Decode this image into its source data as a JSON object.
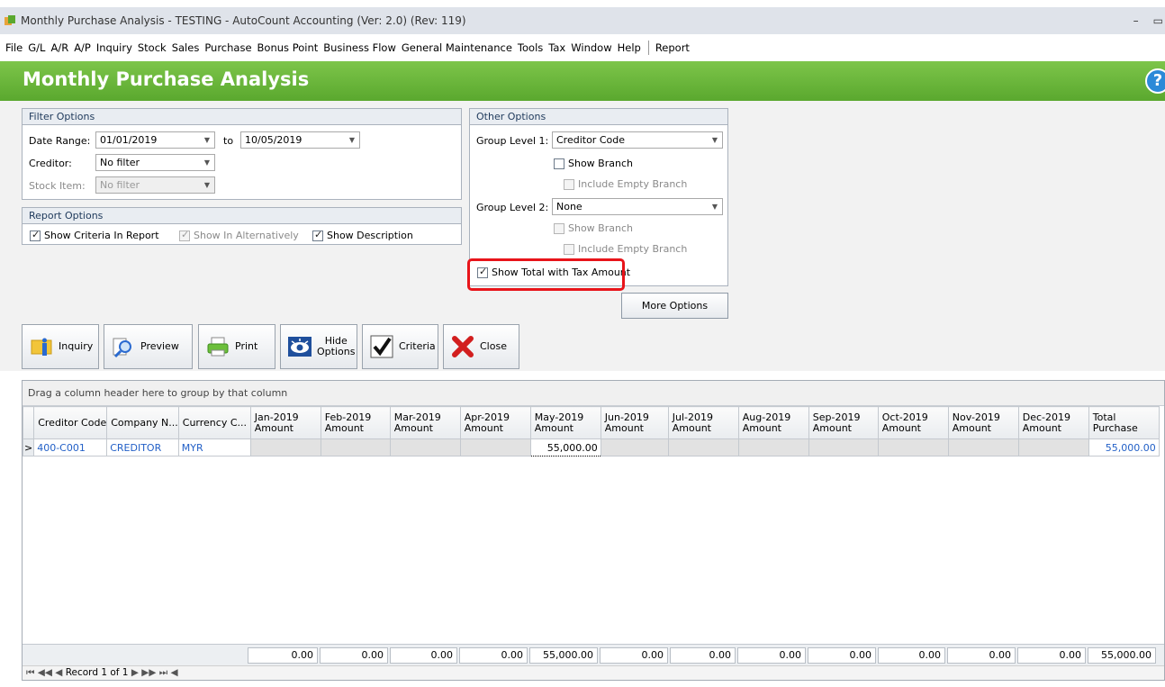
{
  "window": {
    "title": "Monthly Purchase Analysis - TESTING - AutoCount Accounting (Ver: 2.0) (Rev: 119)"
  },
  "menu": [
    "File",
    "G/L",
    "A/R",
    "A/P",
    "Inquiry",
    "Stock",
    "Sales",
    "Purchase",
    "Bonus Point",
    "Business Flow",
    "General Maintenance",
    "Tools",
    "Tax",
    "Window",
    "Help"
  ],
  "menu_report": "Report",
  "header": {
    "title": "Monthly Purchase Analysis",
    "help": "?"
  },
  "filter": {
    "title": "Filter Options",
    "date_label": "Date Range:",
    "date_from": "01/01/2019",
    "to_label": "to",
    "date_to": "10/05/2019",
    "creditor_label": "Creditor:",
    "creditor_value": "No filter",
    "stock_label": "Stock Item:",
    "stock_value": "No filter"
  },
  "report_options": {
    "title": "Report Options",
    "show_criteria": "Show Criteria In Report",
    "show_alt": "Show In Alternatively",
    "show_desc": "Show Description"
  },
  "other": {
    "title": "Other Options",
    "group1_label": "Group Level 1:",
    "group1_value": "Creditor Code",
    "show_branch": "Show Branch",
    "include_empty": "Include Empty Branch",
    "group2_label": "Group Level 2:",
    "group2_value": "None",
    "show_total_tax": "Show Total with Tax Amount",
    "more": "More Options"
  },
  "toolbar": {
    "inquiry": "Inquiry",
    "preview": "Preview",
    "print": "Print",
    "hide1": "Hide",
    "hide2": "Options",
    "criteria": "Criteria",
    "close": "Close"
  },
  "grid": {
    "group_hint": "Drag a column header here to group by that column",
    "headers": [
      "Creditor Code",
      "Company N...",
      "Currency C...",
      "Jan-2019",
      "Feb-2019",
      "Mar-2019",
      "Apr-2019",
      "May-2019",
      "Jun-2019",
      "Jul-2019",
      "Aug-2019",
      "Sep-2019",
      "Oct-2019",
      "Nov-2019",
      "Dec-2019",
      "Total"
    ],
    "sub": "Amount",
    "sub_total": "Purchase",
    "row": {
      "code": "400-C001",
      "company": "CREDITOR",
      "currency": "MYR",
      "may": "55,000.00",
      "total": "55,000.00"
    },
    "footer": [
      "0.00",
      "0.00",
      "0.00",
      "0.00",
      "55,000.00",
      "0.00",
      "0.00",
      "0.00",
      "0.00",
      "0.00",
      "0.00",
      "0.00",
      "55,000.00"
    ],
    "nav": "Record 1 of 1"
  },
  "colors": {
    "header_green": "#5aa82e",
    "highlight_red": "#e8141a",
    "link_blue": "#2360c7"
  }
}
